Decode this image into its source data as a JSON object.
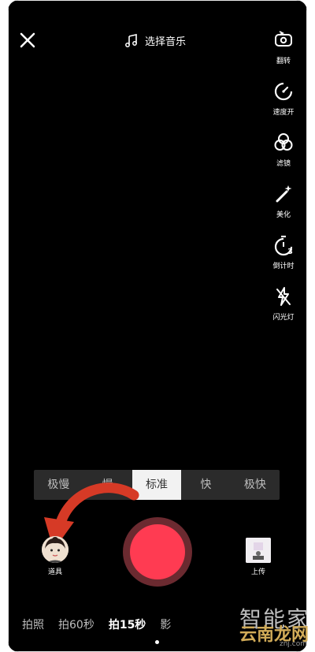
{
  "header": {
    "music_label": "选择音乐"
  },
  "tools": [
    {
      "name": "flip",
      "label": "翻转",
      "icon": "flip-camera-icon"
    },
    {
      "name": "speed",
      "label": "速度开",
      "icon": "speed-icon"
    },
    {
      "name": "filter",
      "label": "滤镜",
      "icon": "filter-icon"
    },
    {
      "name": "beauty",
      "label": "美化",
      "icon": "magic-wand-icon"
    },
    {
      "name": "timer",
      "label": "倒计时",
      "icon": "timer-icon"
    },
    {
      "name": "flash",
      "label": "闪光灯",
      "icon": "flash-off-icon"
    }
  ],
  "speed_options": [
    "极慢",
    "慢",
    "标准",
    "快",
    "极快"
  ],
  "speed_selected": "标准",
  "bottom_left": {
    "label": "道具"
  },
  "bottom_right": {
    "label": "上传"
  },
  "modes": [
    "拍照",
    "拍60秒",
    "拍15秒",
    "影"
  ],
  "active_mode": "拍15秒",
  "watermark": {
    "line1": "智能家",
    "line2": "云南龙网",
    "line3": "znj.com"
  },
  "colors": {
    "record": "#ff3b52",
    "arrow": "#d63a26",
    "speed_bar": "#2b2b2b"
  }
}
